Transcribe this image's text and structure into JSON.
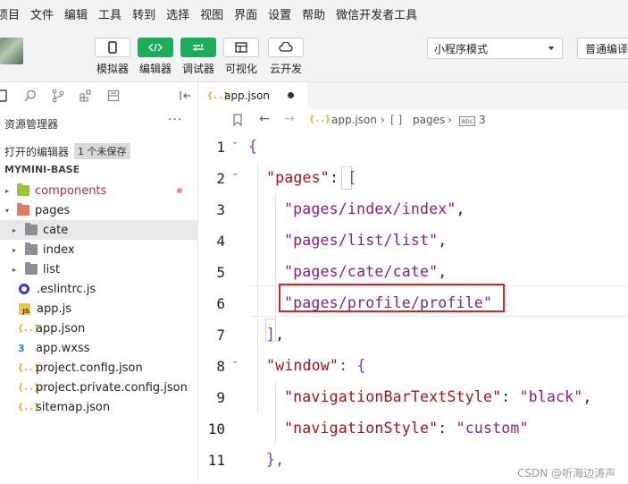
{
  "menu": [
    "项目",
    "文件",
    "编辑",
    "工具",
    "转到",
    "选择",
    "视图",
    "界面",
    "设置",
    "帮助",
    "微信开发者工具"
  ],
  "toolbar": {
    "buttons": [
      {
        "label": "模拟器",
        "icon": "phone-icon"
      },
      {
        "label": "编辑器",
        "icon": "code-icon"
      },
      {
        "label": "调试器",
        "icon": "debug-icon"
      },
      {
        "label": "可视化",
        "icon": "layout-icon"
      },
      {
        "label": "云开发",
        "icon": "cloud-icon"
      }
    ],
    "mode_select": "小程序模式",
    "compile_select": "普通编译"
  },
  "sidebar": {
    "title": "资源管理器",
    "more": "···",
    "open_editors": "打开的编辑器",
    "unsaved": "1 个未保存",
    "project": "MYMINI-BASE",
    "tree": [
      {
        "label": "components",
        "type": "folder-green",
        "arrow": "▸",
        "indent": 0,
        "modified": true
      },
      {
        "label": "pages",
        "type": "folder-orange",
        "arrow": "▾",
        "indent": 0
      },
      {
        "label": "cate",
        "type": "folder",
        "arrow": "▸",
        "indent": 1,
        "selected": true
      },
      {
        "label": "index",
        "type": "folder",
        "arrow": "▸",
        "indent": 1
      },
      {
        "label": "list",
        "type": "folder",
        "arrow": "▸",
        "indent": 1
      },
      {
        "label": ".eslintrc.js",
        "type": "eslint",
        "indent": 0
      },
      {
        "label": "app.js",
        "type": "js",
        "indent": 0
      },
      {
        "label": "app.json",
        "type": "json",
        "indent": 0
      },
      {
        "label": "app.wxss",
        "type": "css",
        "indent": 0
      },
      {
        "label": "project.config.json",
        "type": "json",
        "indent": 0
      },
      {
        "label": "project.private.config.json",
        "type": "json",
        "indent": 0
      },
      {
        "label": "sitemap.json",
        "type": "json",
        "indent": 0
      }
    ]
  },
  "editor": {
    "tab": "app.json",
    "breadcrumb": {
      "file": "app.json",
      "sep1": "›",
      "pages_icon": "[ ]",
      "pages": "pages",
      "sep2": "›",
      "idx_icon": "abc",
      "idx": "3"
    },
    "lines": [
      {
        "n": "1",
        "fold": true
      },
      {
        "n": "2",
        "fold": true
      },
      {
        "n": "3"
      },
      {
        "n": "4"
      },
      {
        "n": "5"
      },
      {
        "n": "6"
      },
      {
        "n": "7"
      },
      {
        "n": "8",
        "fold": true
      },
      {
        "n": "9"
      },
      {
        "n": "10"
      },
      {
        "n": "11"
      }
    ],
    "code": {
      "l1": "{",
      "l2_key": "\"pages\"",
      "l2_colon": ": ",
      "l2_br": "[",
      "l3": "\"pages/index/index\"",
      "l3_c": ",",
      "l4": "\"pages/list/list\"",
      "l4_c": ",",
      "l5": "\"pages/cate/cate\"",
      "l5_c": ",",
      "l6": "\"pages/profile/profile\"",
      "l7_br": "]",
      "l7_c": ",",
      "l8_key": "\"window\"",
      "l8_colon": ": {",
      "l9_key": "\"navigationBarTextStyle\"",
      "l9_colon": ": ",
      "l9_val": "\"black\"",
      "l9_c": ",",
      "l10_key": "\"navigationStyle\"",
      "l10_colon": ": ",
      "l10_val": "\"custom\"",
      "l11": "},"
    }
  },
  "watermark": "CSDN @听海边涛声"
}
